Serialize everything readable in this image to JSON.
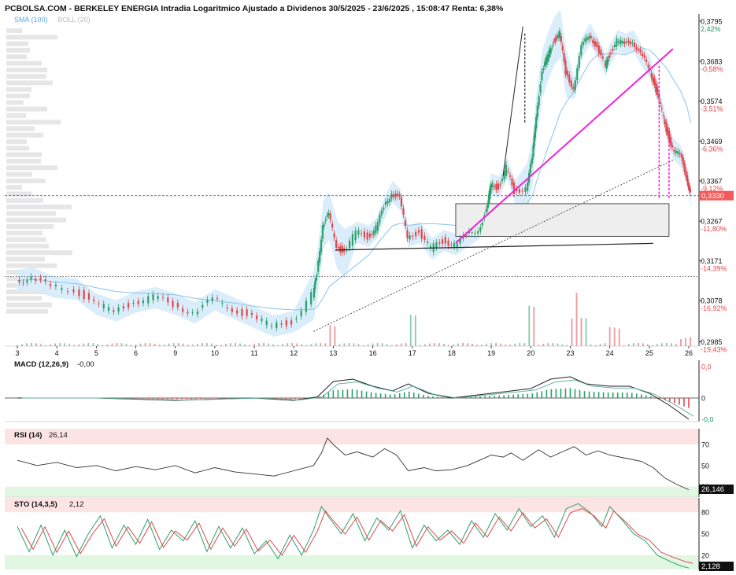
{
  "header": {
    "title": "PCBOLSA.COM - BERKELEY ENERGIA Intradia Logaritmico Ajustado a Dividenos 30/5/2025 - 23/6/2025 , 15:08:47 Renta: 6,38%",
    "indicators": [
      {
        "text": "SMA (100)",
        "color": "#5aa9e6"
      },
      {
        "text": "BOLL (20)",
        "color": "#bbbbbb"
      }
    ]
  },
  "colors": {
    "up": "#2aa06a",
    "down": "#e0474c",
    "boll_fill": "#d6ebfa",
    "sma": "#8cc3ec",
    "trend_pink": "#ee22dd",
    "price_tag": "#f15b5b",
    "pct_up": "#1a9a5a",
    "pct_down": "#e0474c",
    "rsi_hi_band": "#fde4e4",
    "rsi_lo_band": "#e2f7e2"
  },
  "chart_data": [
    {
      "type": "candlestick",
      "name": "price",
      "x_tick_labels": [
        "3",
        "4",
        "5",
        "6",
        "9",
        "10",
        "11",
        "12",
        "13",
        "16",
        "17",
        "18",
        "19",
        "20",
        "23",
        "24",
        "25",
        "26"
      ],
      "y_scale": "log",
      "y_ticks": [
        {
          "price": "0,3795",
          "pct": "2,42%",
          "dir": "up"
        },
        {
          "price": "0,3683",
          "pct": "-0,58%",
          "dir": "down"
        },
        {
          "price": "0,3574",
          "pct": "-3,51%",
          "dir": "down"
        },
        {
          "price": "0,3469",
          "pct": "-6,36%",
          "dir": "down"
        },
        {
          "price": "0,3367",
          "pct": "-9,12%",
          "dir": "down"
        },
        {
          "price": "0,3267",
          "pct": "-11,80%",
          "dir": "down"
        },
        {
          "price": "0,3171",
          "pct": "-14,39%",
          "dir": "down"
        },
        {
          "price": "0,3078",
          "pct": "-16,92%",
          "dir": "down"
        },
        {
          "price": "0,2985",
          "pct": "-19,43%",
          "dir": "down"
        }
      ],
      "last_price": "0,3330",
      "ylim": [
        0.2975,
        0.3815
      ],
      "path": [
        [
          0,
          0.3125
        ],
        [
          0.4,
          0.313
        ],
        [
          0.9,
          0.311
        ],
        [
          1.5,
          0.3105
        ],
        [
          2,
          0.307
        ],
        [
          2.5,
          0.3055
        ],
        [
          3,
          0.3075
        ],
        [
          3.5,
          0.3085
        ],
        [
          4,
          0.307
        ],
        [
          4.5,
          0.305
        ],
        [
          5,
          0.308
        ],
        [
          5.5,
          0.306
        ],
        [
          6,
          0.304
        ],
        [
          6.5,
          0.302
        ],
        [
          7,
          0.303
        ],
        [
          7.5,
          0.309
        ],
        [
          7.6,
          0.314
        ],
        [
          7.75,
          0.326
        ],
        [
          7.9,
          0.328
        ],
        [
          8.1,
          0.321
        ],
        [
          8.3,
          0.319
        ],
        [
          8.6,
          0.324
        ],
        [
          8.9,
          0.323
        ],
        [
          9.1,
          0.325
        ],
        [
          9.3,
          0.33
        ],
        [
          9.5,
          0.334
        ],
        [
          9.7,
          0.332
        ],
        [
          9.9,
          0.323
        ],
        [
          10.2,
          0.324
        ],
        [
          10.5,
          0.32
        ],
        [
          10.8,
          0.322
        ],
        [
          11.1,
          0.321
        ],
        [
          11.4,
          0.323
        ],
        [
          11.7,
          0.325
        ],
        [
          11.9,
          0.329
        ],
        [
          12,
          0.336
        ],
        [
          12.2,
          0.335
        ],
        [
          12.4,
          0.34
        ],
        [
          12.6,
          0.334
        ],
        [
          12.9,
          0.335
        ],
        [
          13.05,
          0.342
        ],
        [
          13.15,
          0.354
        ],
        [
          13.3,
          0.365
        ],
        [
          13.45,
          0.37
        ],
        [
          13.6,
          0.374
        ],
        [
          13.75,
          0.376
        ],
        [
          13.9,
          0.365
        ],
        [
          14.1,
          0.361
        ],
        [
          14.3,
          0.372
        ],
        [
          14.5,
          0.376
        ],
        [
          14.7,
          0.372
        ],
        [
          14.9,
          0.367
        ],
        [
          15,
          0.37
        ],
        [
          15.2,
          0.374
        ],
        [
          15.4,
          0.373
        ],
        [
          15.6,
          0.374
        ],
        [
          15.8,
          0.37
        ],
        [
          16,
          0.367
        ],
        [
          16.15,
          0.362
        ],
        [
          16.3,
          0.356
        ],
        [
          16.45,
          0.35
        ],
        [
          16.6,
          0.345
        ],
        [
          16.8,
          0.343
        ],
        [
          16.95,
          0.3385
        ],
        [
          17.05,
          0.3332
        ]
      ]
    },
    {
      "type": "bar",
      "name": "volume",
      "note": "volume histogram along the bottom of the price panel",
      "peaks": [
        [
          8,
          6
        ],
        [
          10,
          9
        ],
        [
          13,
          12
        ],
        [
          14.1,
          8
        ],
        [
          14.3,
          8
        ],
        [
          15.1,
          5
        ],
        [
          16.9,
          2
        ]
      ]
    },
    {
      "type": "macd",
      "label": "MACD (12,26,9)",
      "value": "-0,00",
      "ylabels": [
        "0,0",
        "0",
        "-0,0"
      ],
      "macd_path": [
        [
          0,
          0
        ],
        [
          2,
          0
        ],
        [
          3,
          -0.05
        ],
        [
          4,
          -0.1
        ],
        [
          5,
          -0.05
        ],
        [
          6,
          0
        ],
        [
          7,
          -0.1
        ],
        [
          7.6,
          0.05
        ],
        [
          8,
          0.7
        ],
        [
          8.5,
          0.8
        ],
        [
          9,
          0.5
        ],
        [
          9.5,
          0.3
        ],
        [
          9.9,
          0.6
        ],
        [
          10.4,
          0.2
        ],
        [
          11,
          0
        ],
        [
          12,
          0.2
        ],
        [
          12.5,
          0.3
        ],
        [
          13,
          0.4
        ],
        [
          13.5,
          0.8
        ],
        [
          14,
          0.9
        ],
        [
          14.4,
          0.6
        ],
        [
          15,
          0.5
        ],
        [
          15.5,
          0.5
        ],
        [
          16,
          0.2
        ],
        [
          16.5,
          -0.3
        ],
        [
          17,
          -0.9
        ]
      ]
    },
    {
      "type": "line",
      "name": "rsi",
      "label": "RSI (14)",
      "value": "26,14",
      "last_tag": "26,146",
      "bands": [
        70,
        30
      ],
      "ylabels": [
        "70",
        "50",
        "30"
      ],
      "ylim": [
        20,
        85
      ],
      "path": [
        [
          0,
          55
        ],
        [
          0.5,
          50
        ],
        [
          1,
          53
        ],
        [
          1.5,
          48
        ],
        [
          2,
          50
        ],
        [
          2.5,
          45
        ],
        [
          3,
          49
        ],
        [
          3.5,
          46
        ],
        [
          4,
          50
        ],
        [
          4.5,
          43
        ],
        [
          5,
          48
        ],
        [
          5.5,
          44
        ],
        [
          6,
          42
        ],
        [
          6.5,
          40
        ],
        [
          7,
          45
        ],
        [
          7.5,
          50
        ],
        [
          7.7,
          62
        ],
        [
          7.85,
          76
        ],
        [
          8,
          70
        ],
        [
          8.3,
          60
        ],
        [
          8.6,
          63
        ],
        [
          9,
          58
        ],
        [
          9.3,
          66
        ],
        [
          9.6,
          60
        ],
        [
          9.9,
          45
        ],
        [
          10.3,
          48
        ],
        [
          10.6,
          45
        ],
        [
          11,
          46
        ],
        [
          11.4,
          50
        ],
        [
          11.7,
          55
        ],
        [
          12,
          60
        ],
        [
          12.3,
          58
        ],
        [
          12.5,
          62
        ],
        [
          12.8,
          55
        ],
        [
          13,
          60
        ],
        [
          13.2,
          65
        ],
        [
          13.5,
          58
        ],
        [
          13.8,
          63
        ],
        [
          14.1,
          68
        ],
        [
          14.4,
          60
        ],
        [
          14.7,
          64
        ],
        [
          15,
          60
        ],
        [
          15.4,
          57
        ],
        [
          15.8,
          54
        ],
        [
          16.1,
          48
        ],
        [
          16.4,
          38
        ],
        [
          16.7,
          32
        ],
        [
          17.0,
          27
        ]
      ]
    },
    {
      "type": "line",
      "name": "stochastic",
      "label": "STO (14,3,5)",
      "value": "2,12",
      "last_tag": "2,128",
      "bands": [
        80,
        20
      ],
      "ylabels": [
        "80",
        "50",
        "20"
      ],
      "ylim": [
        0,
        100
      ],
      "path": [
        [
          0,
          60
        ],
        [
          0.3,
          25
        ],
        [
          0.6,
          62
        ],
        [
          0.9,
          20
        ],
        [
          1.2,
          55
        ],
        [
          1.5,
          18
        ],
        [
          1.8,
          50
        ],
        [
          2.1,
          75
        ],
        [
          2.4,
          30
        ],
        [
          2.7,
          62
        ],
        [
          3,
          35
        ],
        [
          3.3,
          70
        ],
        [
          3.6,
          28
        ],
        [
          3.9,
          55
        ],
        [
          4.2,
          40
        ],
        [
          4.5,
          68
        ],
        [
          4.8,
          25
        ],
        [
          5.1,
          60
        ],
        [
          5.4,
          30
        ],
        [
          5.7,
          58
        ],
        [
          6,
          22
        ],
        [
          6.3,
          40
        ],
        [
          6.6,
          15
        ],
        [
          6.9,
          48
        ],
        [
          7.2,
          20
        ],
        [
          7.5,
          55
        ],
        [
          7.7,
          88
        ],
        [
          7.9,
          72
        ],
        [
          8.2,
          50
        ],
        [
          8.5,
          78
        ],
        [
          8.8,
          40
        ],
        [
          9.1,
          72
        ],
        [
          9.4,
          55
        ],
        [
          9.7,
          82
        ],
        [
          10,
          30
        ],
        [
          10.3,
          62
        ],
        [
          10.6,
          40
        ],
        [
          10.9,
          55
        ],
        [
          11.2,
          35
        ],
        [
          11.5,
          68
        ],
        [
          11.8,
          45
        ],
        [
          12.1,
          78
        ],
        [
          12.4,
          55
        ],
        [
          12.7,
          85
        ],
        [
          13,
          60
        ],
        [
          13.3,
          75
        ],
        [
          13.6,
          45
        ],
        [
          13.9,
          85
        ],
        [
          14.2,
          92
        ],
        [
          14.5,
          80
        ],
        [
          14.8,
          60
        ],
        [
          15,
          88
        ],
        [
          15.3,
          70
        ],
        [
          15.6,
          50
        ],
        [
          15.9,
          40
        ],
        [
          16.2,
          20
        ],
        [
          16.5,
          12
        ],
        [
          16.8,
          5
        ],
        [
          17,
          2
        ]
      ]
    }
  ]
}
